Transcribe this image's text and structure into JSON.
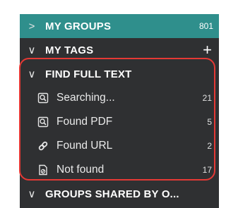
{
  "sidebar": {
    "my_groups": {
      "chevron": ">",
      "title": "MY GROUPS",
      "count": "801"
    },
    "my_tags": {
      "chevron": "∨",
      "title": "MY TAGS",
      "add": "+"
    },
    "find_full_text": {
      "chevron": "∨",
      "title": "FIND FULL TEXT",
      "items": [
        {
          "icon": "search-document-icon",
          "label": "Searching...",
          "count": "21"
        },
        {
          "icon": "search-document-icon",
          "label": "Found PDF",
          "count": "5"
        },
        {
          "icon": "link-icon",
          "label": "Found URL",
          "count": "2"
        },
        {
          "icon": "not-found-document-icon",
          "label": "Not found",
          "count": "17"
        }
      ]
    },
    "groups_shared": {
      "chevron": "∨",
      "title": "GROUPS SHARED BY O..."
    }
  },
  "colors": {
    "panel_bg": "#2f3032",
    "selected_bg": "#2f8f8c",
    "highlight_outline": "#e53935"
  }
}
